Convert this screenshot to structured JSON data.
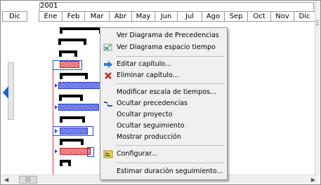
{
  "timeline": {
    "year": "2001",
    "months": [
      "Dic",
      "Ene",
      "Feb",
      "Mar",
      "Abr",
      "May",
      "Jun",
      "Jul",
      "Ago",
      "Sep",
      "Oct",
      "Nov",
      "Dic"
    ]
  },
  "context_menu": {
    "items": [
      {
        "label": "Ver Diagrama de Precedencias",
        "icon": "none"
      },
      {
        "label": "Ver Diagrama espacio tiempo",
        "icon": "time-space-diagram-icon"
      },
      {
        "label": "Editar capítulo...",
        "icon": "blue-arrow-icon"
      },
      {
        "label": "Eliminar capítulo...",
        "icon": "red-x-icon"
      },
      {
        "label": "Modificar escala de tiempos...",
        "icon": "none"
      },
      {
        "label": "Ocultar precedencias",
        "icon": "precedence-icon"
      },
      {
        "label": "Ocultar proyecto",
        "icon": "none"
      },
      {
        "label": "Ocultar seguimiento",
        "icon": "none"
      },
      {
        "label": "Mostrar producción",
        "icon": "none"
      },
      {
        "label": "Configurar...",
        "icon": "configure-icon"
      },
      {
        "label": "Estimar duración seguimiento...",
        "icon": "none"
      }
    ]
  },
  "colors": {
    "summary_bar": "#000000",
    "task_blue": "#1e3fd8",
    "task_red": "#c81c1c",
    "today_line": "#e03030",
    "menu_bg": "#f0f0f0"
  }
}
